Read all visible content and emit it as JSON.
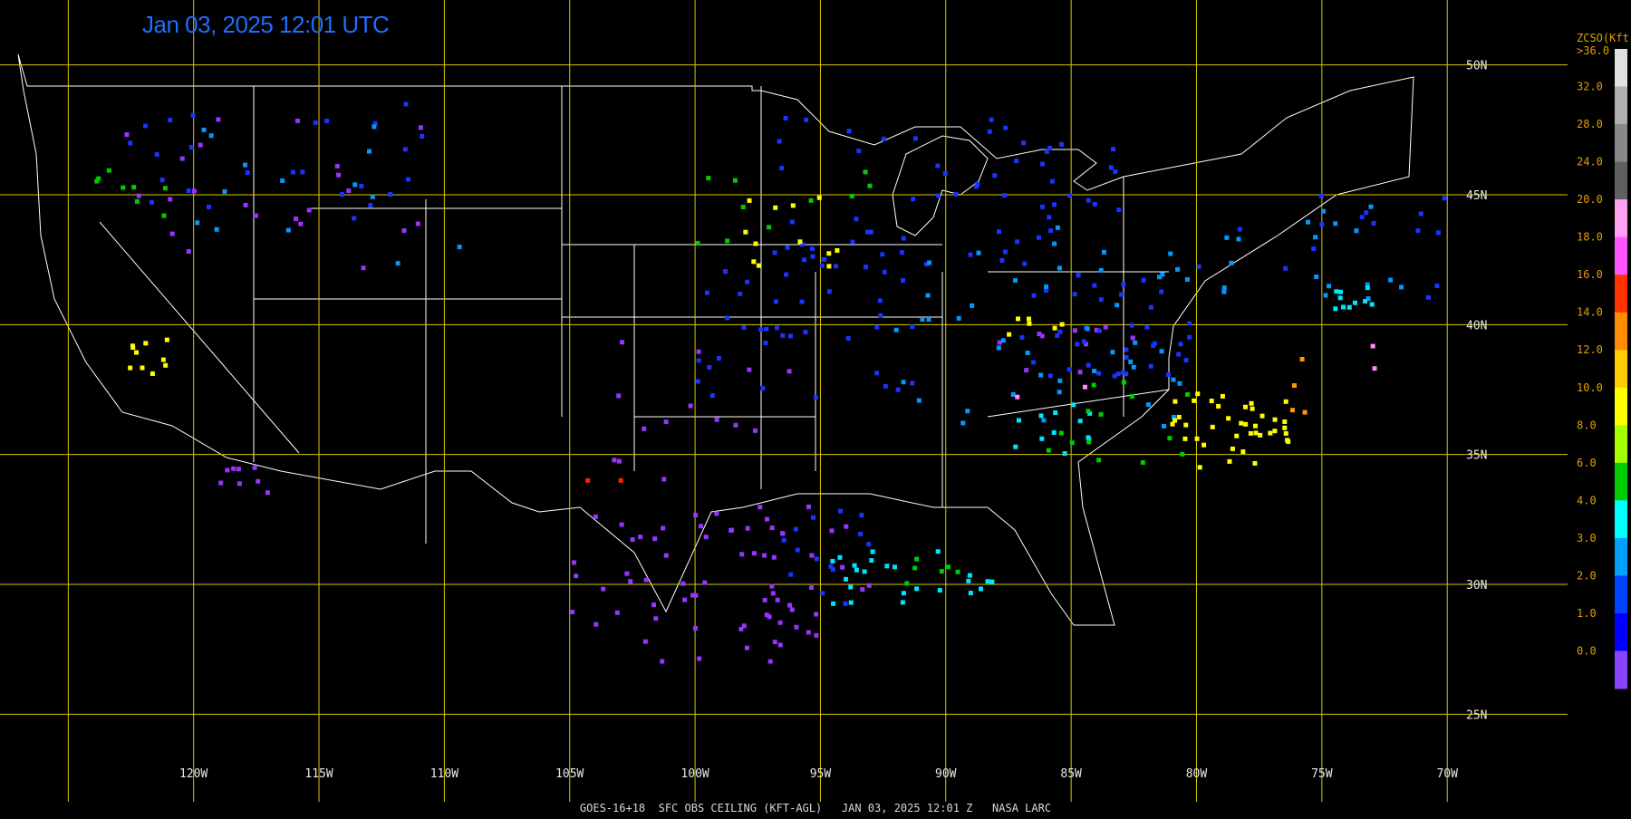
{
  "title": "Jan 03, 2025 12:01 UTC",
  "footer": "GOES-16+18  SFC OBS CEILING (KFT-AGL)   JAN 03, 2025 12:01 Z   NASA LARC",
  "map": {
    "lon_range": [
      -127,
      -65.2
    ],
    "lat_range": [
      22.5,
      52.5
    ],
    "lat_lines": [
      25,
      30,
      35,
      40,
      45,
      50
    ],
    "lat_labels": [
      "25N",
      "30N",
      "35N",
      "40N",
      "45N",
      "50N"
    ],
    "lon_lines": [
      -125,
      -120,
      -115,
      -110,
      -105,
      -100,
      -95,
      -90,
      -85,
      -80,
      -75,
      -70
    ],
    "lon_labels": [
      "120W",
      "115W",
      "110W",
      "105W",
      "100W",
      "95W",
      "90W",
      "85W",
      "80W",
      "75W",
      "70W"
    ],
    "grid_color": "#d8c800",
    "boundary_color": "#ffffff"
  },
  "legend": {
    "title": "ZCSO(Kft)",
    "top_label": ">36.0",
    "labels": [
      "32.0",
      "28.0",
      "24.0",
      "20.0",
      "18.0",
      "16.0",
      "14.0",
      "12.0",
      "10.0",
      "8.0",
      "6.0",
      "4.0",
      "3.0",
      "2.0",
      "1.0",
      "0.0"
    ],
    "colors": [
      "#e0e0e0",
      "#b0b0b0",
      "#888888",
      "#606060",
      "#ffa0f0",
      "#ff55ff",
      "#ff3300",
      "#ff8c00",
      "#ffcc00",
      "#ffff00",
      "#a6ff00",
      "#00cc00",
      "#00ffff",
      "#00a0ff",
      "#0044ff",
      "#0000ff",
      "#8844ff"
    ]
  },
  "observation_classes": {
    "purple": "#9933ff",
    "blue": "#1a33ff",
    "lightblue": "#0099ff",
    "cyan": "#00e5ff",
    "green": "#00cc00",
    "lime": "#88ee00",
    "yellow": "#ffff00",
    "orange": "#ff9900",
    "red": "#ff2200",
    "pink": "#ff88ff"
  },
  "observation_regions": [
    {
      "cls": "purple",
      "lon": [
        -105,
        -93
      ],
      "lat": [
        27,
        33
      ],
      "n": 70
    },
    {
      "cls": "purple",
      "lon": [
        -104,
        -96
      ],
      "lat": [
        34,
        40
      ],
      "n": 14
    },
    {
      "cls": "purple",
      "lon": [
        -124,
        -110
      ],
      "lat": [
        42,
        48
      ],
      "n": 22
    },
    {
      "cls": "purple",
      "lon": [
        -119,
        -117
      ],
      "lat": [
        33.5,
        34.5
      ],
      "n": 8
    },
    {
      "cls": "purple",
      "lon": [
        -88,
        -82
      ],
      "lat": [
        38,
        40
      ],
      "n": 10
    },
    {
      "cls": "blue",
      "lon": [
        -97,
        -83
      ],
      "lat": [
        42,
        48
      ],
      "n": 60
    },
    {
      "cls": "blue",
      "lon": [
        -100,
        -91
      ],
      "lat": [
        37,
        43
      ],
      "n": 40
    },
    {
      "cls": "blue",
      "lon": [
        -87,
        -80
      ],
      "lat": [
        38,
        42
      ],
      "n": 40
    },
    {
      "cls": "blue",
      "lon": [
        -124,
        -110
      ],
      "lat": [
        44,
        48.5
      ],
      "n": 25
    },
    {
      "cls": "blue",
      "lon": [
        -80,
        -70
      ],
      "lat": [
        41,
        45
      ],
      "n": 15
    },
    {
      "cls": "blue",
      "lon": [
        -97,
        -93
      ],
      "lat": [
        29,
        33
      ],
      "n": 14
    },
    {
      "cls": "lightblue",
      "lon": [
        -92,
        -80
      ],
      "lat": [
        36,
        44
      ],
      "n": 45
    },
    {
      "cls": "lightblue",
      "lon": [
        -120,
        -108
      ],
      "lat": [
        42,
        48
      ],
      "n": 14
    },
    {
      "cls": "lightblue",
      "lon": [
        -79,
        -71
      ],
      "lat": [
        41,
        45
      ],
      "n": 18
    },
    {
      "cls": "cyan",
      "lon": [
        -95,
        -88
      ],
      "lat": [
        29.2,
        31.5
      ],
      "n": 24
    },
    {
      "cls": "cyan",
      "lon": [
        -88,
        -84
      ],
      "lat": [
        35,
        37
      ],
      "n": 12
    },
    {
      "cls": "cyan",
      "lon": [
        -74.5,
        -72.5
      ],
      "lat": [
        40.5,
        41.5
      ],
      "n": 10
    },
    {
      "cls": "green",
      "lon": [
        -100,
        -93
      ],
      "lat": [
        43,
        46
      ],
      "n": 10
    },
    {
      "cls": "green",
      "lon": [
        -90,
        -80
      ],
      "lat": [
        34.5,
        38
      ],
      "n": 14
    },
    {
      "cls": "green",
      "lon": [
        -124,
        -121
      ],
      "lat": [
        44,
        46
      ],
      "n": 8
    },
    {
      "cls": "green",
      "lon": [
        -92,
        -88
      ],
      "lat": [
        30,
        31
      ],
      "n": 6
    },
    {
      "cls": "yellow",
      "lon": [
        -81,
        -76
      ],
      "lat": [
        34.5,
        37.5
      ],
      "n": 40
    },
    {
      "cls": "yellow",
      "lon": [
        -98,
        -93
      ],
      "lat": [
        42,
        45
      ],
      "n": 12
    },
    {
      "cls": "yellow",
      "lon": [
        -123,
        -121
      ],
      "lat": [
        38,
        39.5
      ],
      "n": 10
    },
    {
      "cls": "yellow",
      "lon": [
        -88,
        -85
      ],
      "lat": [
        39.5,
        40.5
      ],
      "n": 6
    },
    {
      "cls": "orange",
      "lon": [
        -77,
        -75.5
      ],
      "lat": [
        36.5,
        39
      ],
      "n": 4
    },
    {
      "cls": "red",
      "lon": [
        -118.5,
        -83.5
      ],
      "lat": [
        34,
        34
      ],
      "n": 2
    },
    {
      "cls": "pink",
      "lon": [
        -96,
        -72
      ],
      "lat": [
        36,
        40
      ],
      "n": 4
    }
  ]
}
